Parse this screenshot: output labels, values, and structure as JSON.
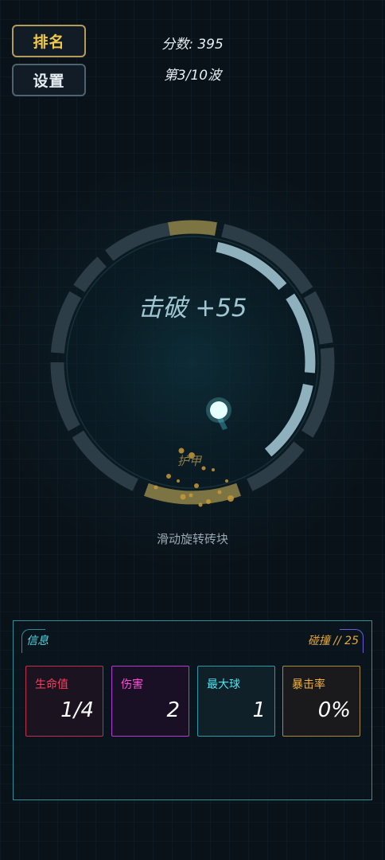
{
  "top_buttons": {
    "rank_label": "排名",
    "settings_label": "设置"
  },
  "hud": {
    "score": "分数: 395",
    "wave": "第3/10波"
  },
  "arena": {
    "break_text": "击破 +55",
    "armor_text": "护甲",
    "hint": "滑动旋转砖块"
  },
  "info_panel": {
    "title": "信息",
    "hits": "碰撞 // 25",
    "stats": [
      {
        "label": "生命值",
        "value": "1/4"
      },
      {
        "label": "伤害",
        "value": "2"
      },
      {
        "label": "最大球",
        "value": "1"
      },
      {
        "label": "暴击率",
        "value": "0%"
      }
    ]
  },
  "colors": {
    "accent_gold": "#f0c84a",
    "ring_segment": "#2c3d47",
    "paddle": "#8fb1be",
    "armor": "#7d7444",
    "ball": "#e6ffff"
  }
}
